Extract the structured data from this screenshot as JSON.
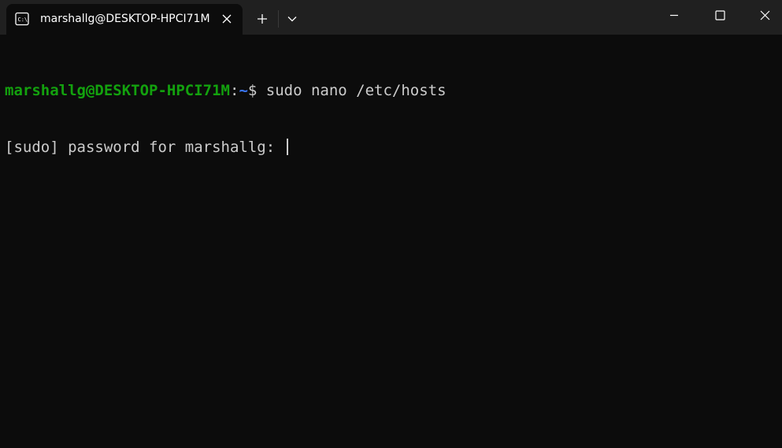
{
  "tab": {
    "title": "marshallg@DESKTOP-HPCI71M",
    "icon": "terminal-icon"
  },
  "titlebar": {
    "new_tab_icon": "plus-icon",
    "dropdown_icon": "chevron-down-icon",
    "minimize_icon": "minimize-icon",
    "maximize_icon": "maximize-icon",
    "close_icon": "close-icon"
  },
  "terminal": {
    "line1": {
      "user_host": "marshallg@DESKTOP-HPCI71M",
      "separator": ":",
      "path": "~",
      "prompt_symbol": "$",
      "command": " sudo nano /etc/hosts"
    },
    "line2": {
      "text": "[sudo] password for marshallg: "
    }
  },
  "colors": {
    "background": "#0c0c0c",
    "titlebar": "#202020",
    "prompt_user": "#13a10e",
    "prompt_path": "#3b78ff",
    "text": "#cccccc"
  }
}
